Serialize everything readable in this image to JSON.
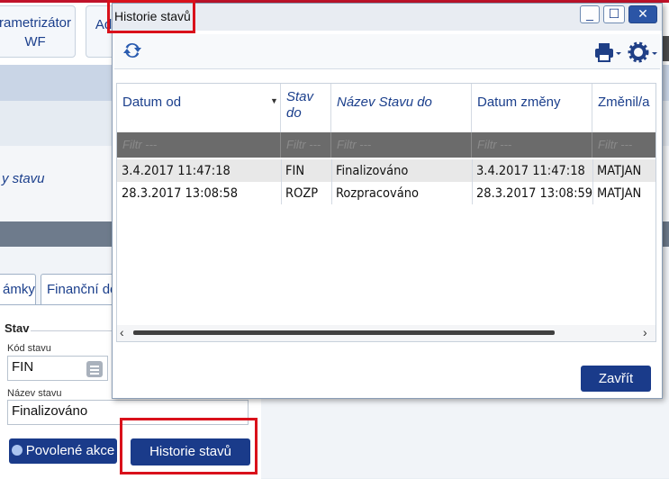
{
  "app": {
    "top_buttons": [
      {
        "label_line1": "rametrizátor",
        "label_line2": "WF"
      },
      {
        "label_line1": "Ad",
        "label_line2": ""
      }
    ],
    "state_label": "y stavu",
    "tabs": [
      "ámky",
      "Finanční do"
    ],
    "form": {
      "section_title": "Stav",
      "kod_label": "Kód stavu",
      "kod_value": "FIN",
      "nazev_label": "Název stavu",
      "nazev_value": "Finalizováno"
    },
    "buttons": {
      "povolene_akce": "Povolené akce",
      "historie_stavu": "Historie stavů"
    }
  },
  "dialog": {
    "title": "Historie stavů",
    "window_buttons": {
      "minimize": "_",
      "maximize": "☐",
      "close": "✕"
    },
    "columns": [
      {
        "label": "Datum od",
        "italic": false
      },
      {
        "label": "Stav do",
        "italic": true
      },
      {
        "label": "Název Stavu do",
        "italic": true
      },
      {
        "label": "Datum změny",
        "italic": false
      },
      {
        "label": "Změnil/a",
        "italic": false
      }
    ],
    "filter_placeholder": "Filtr ---",
    "rows": [
      [
        "3.4.2017 11:47:18",
        "FIN",
        "Finalizováno",
        "3.4.2017 11:47:18",
        "MATJAN"
      ],
      [
        "28.3.2017 13:08:58",
        "ROZP",
        "Rozpracováno",
        "28.3.2017 13:08:59",
        "MATJAN"
      ]
    ],
    "close_button": "Zavřít"
  },
  "colors": {
    "accent": "#1a3b8a",
    "highlight": "#d9111b"
  },
  "icons": [
    "refresh-icon",
    "print-icon",
    "settings-gear-icon",
    "sort-arrow-icon",
    "scroll-left-icon",
    "scroll-right-icon",
    "list-icon",
    "actions-icon"
  ]
}
